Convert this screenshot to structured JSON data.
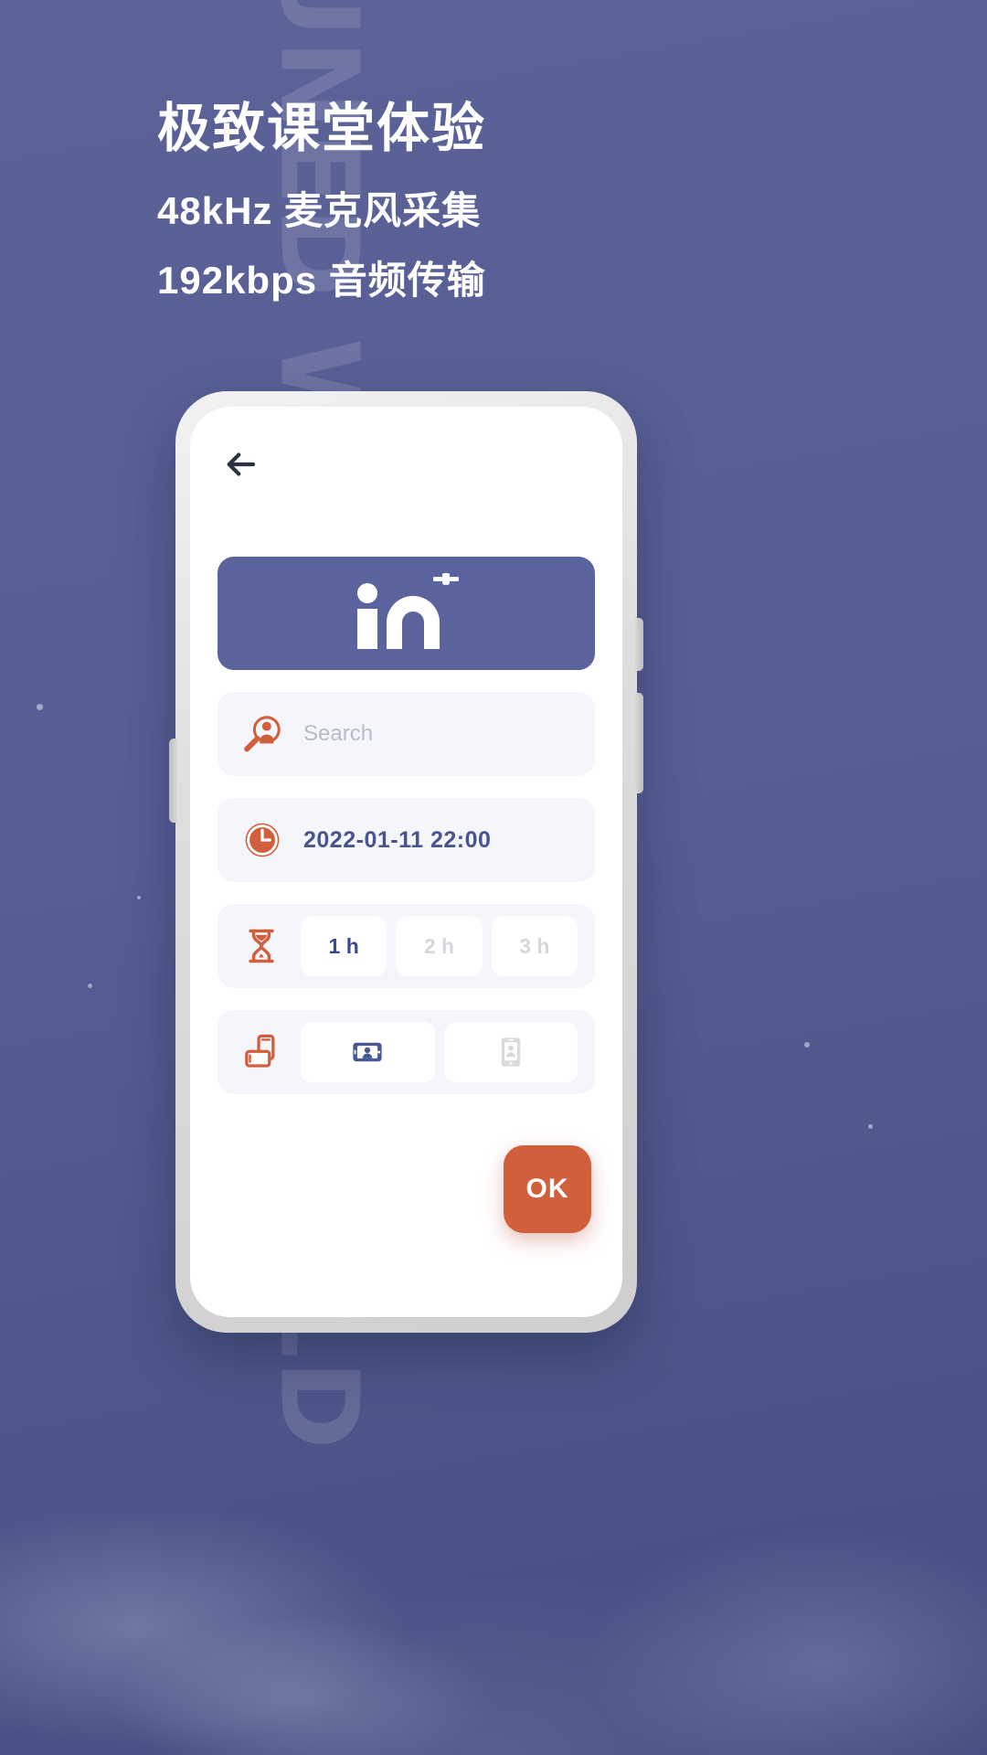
{
  "background": {
    "watermark_text": "STAY TUNED WITH THE WORLD",
    "brand_blue": "#5a639c",
    "accent_orange": "#d25f3c"
  },
  "promo": {
    "headline": "极致课堂体验",
    "sub1": "48kHz 麦克风采集",
    "sub2": "192kbps 音频传输"
  },
  "app": {
    "back_icon": "arrow-left-icon",
    "logo": {
      "mark": "in-plus-logo",
      "text": "in+"
    },
    "search": {
      "icon": "person-search-icon",
      "placeholder": "Search",
      "value": ""
    },
    "datetime": {
      "icon": "clock-icon",
      "value": "2022-01-11  22:00"
    },
    "duration": {
      "icon": "hourglass-icon",
      "options": [
        {
          "label": "1 h",
          "selected": true
        },
        {
          "label": "2 h",
          "selected": false
        },
        {
          "label": "3 h",
          "selected": false
        }
      ]
    },
    "orientation": {
      "icon": "rotate-device-icon",
      "options": [
        {
          "name": "landscape-icon",
          "selected": true
        },
        {
          "name": "portrait-icon",
          "selected": false
        }
      ]
    },
    "confirm_button": "OK"
  }
}
